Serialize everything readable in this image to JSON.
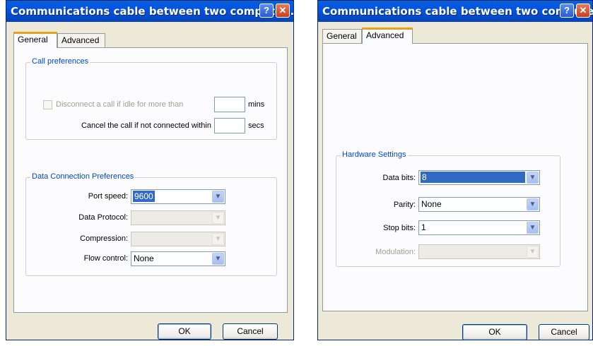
{
  "left_dialog": {
    "title": "Communications cable between two compute...",
    "help_glyph": "?",
    "close_glyph": "✕",
    "tabs": [
      {
        "label": "General",
        "active": true
      },
      {
        "label": "Advanced",
        "active": false
      }
    ],
    "call_preferences": {
      "legend": "Call preferences",
      "disconnect_label": "Disconnect a call if idle for more than",
      "disconnect_value": "",
      "disconnect_unit": "mins",
      "disconnect_checked": false,
      "cancel_label": "Cancel the call if not connected within",
      "cancel_value": "",
      "cancel_unit": "secs"
    },
    "data_connection": {
      "legend": "Data Connection Preferences",
      "port_speed_label": "Port speed:",
      "port_speed_value": "9600",
      "data_protocol_label": "Data Protocol:",
      "data_protocol_value": "",
      "compression_label": "Compression:",
      "compression_value": "",
      "flow_control_label": "Flow control:",
      "flow_control_value": "None"
    },
    "ok_label": "OK",
    "cancel_label": "Cancel"
  },
  "right_dialog": {
    "title": "Communications cable between two compute...",
    "help_glyph": "?",
    "close_glyph": "✕",
    "tabs": [
      {
        "label": "General",
        "active": false
      },
      {
        "label": "Advanced",
        "active": true
      }
    ],
    "hardware": {
      "legend": "Hardware Settings",
      "data_bits_label": "Data bits:",
      "data_bits_value": "8",
      "parity_label": "Parity:",
      "parity_value": "None",
      "stop_bits_label": "Stop bits:",
      "stop_bits_value": "1",
      "modulation_label": "Modulation:",
      "modulation_value": ""
    },
    "ok_label": "OK",
    "cancel_label": "Cancel"
  },
  "icons": {
    "dropdown_arrow": "▼"
  },
  "colors": {
    "titlebar": "#0054e3",
    "dialog_bg": "#ece9d8",
    "group_legend": "#0046d5",
    "selection": "#316ac5",
    "tab_highlight": "#e7a21c"
  }
}
